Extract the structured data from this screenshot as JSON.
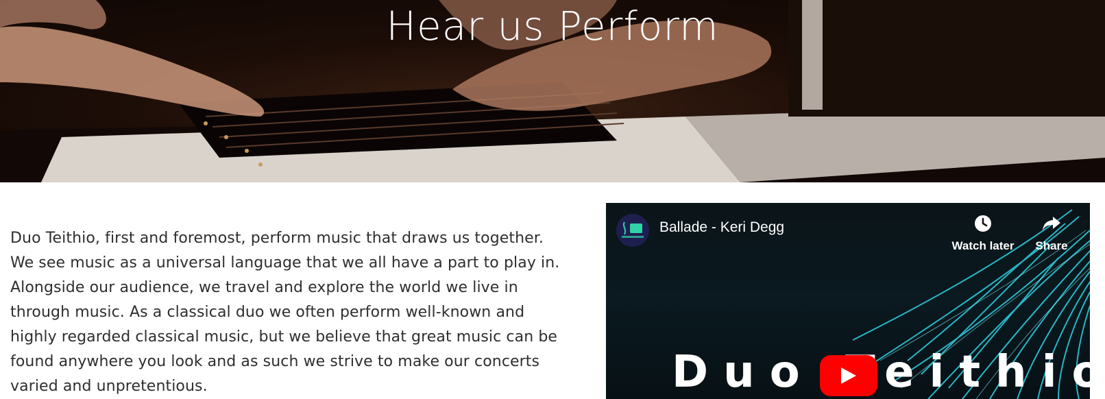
{
  "hero": {
    "title": "Hear us Perform"
  },
  "intro": {
    "paragraph": "Duo Teithio, first and foremost, perform music that draws us together. We see music as a universal language that we all have a part to play in. Alongside our audience, we travel and explore the world we live in through music. As a classical duo we often perform well-known and highly regarded classical music, but we believe that great music can be found anywhere you look and as such we strive to make our concerts varied and unpretentious."
  },
  "video": {
    "title": "Ballade - Keri Degg",
    "channel_avatar_text": "Duo Teithio",
    "watch_later_label": "Watch later",
    "share_label": "Share",
    "thumbnail_text": "Duo Teithio",
    "icons": {
      "watch_later": "clock-icon",
      "share": "share-arrow-icon",
      "play": "youtube-play-icon"
    },
    "colors": {
      "play_button": "#ff0000",
      "accent_fibers": "#2fd3e6",
      "avatar_bg": "#1e1f4f"
    }
  }
}
